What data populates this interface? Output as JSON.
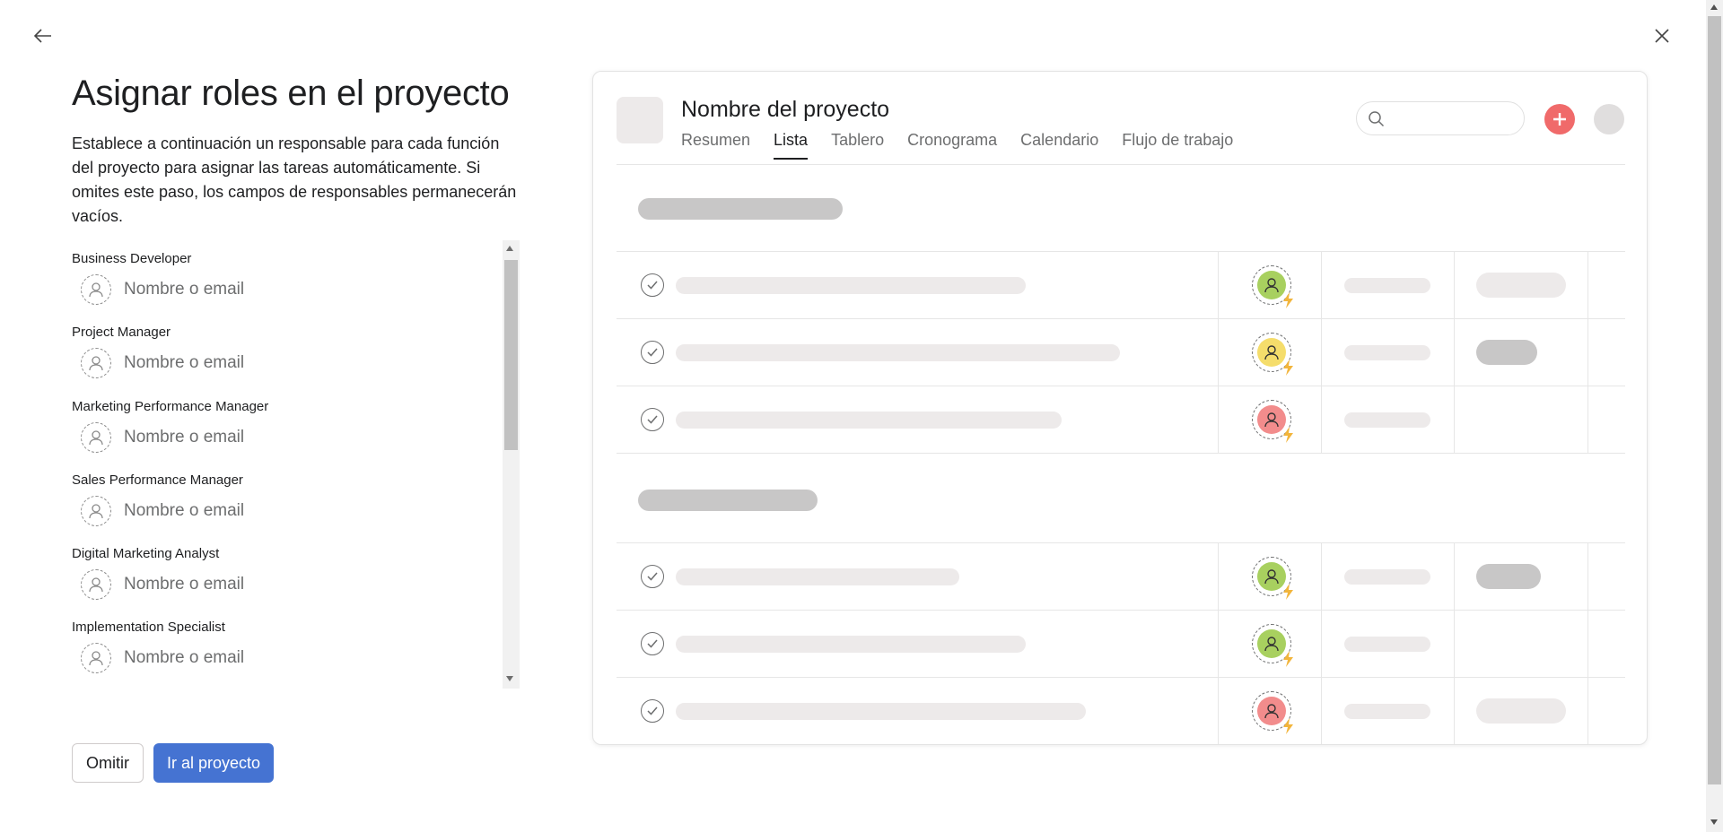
{
  "page": {
    "title": "Asignar roles en el proyecto",
    "description": "Establece a continuación un responsable para cada función del proyecto para asignar las tareas automáticamente. Si omites este paso, los campos de responsables permanecerán vacíos."
  },
  "roles": [
    {
      "label": "Business Developer",
      "placeholder": "Nombre o email"
    },
    {
      "label": "Project Manager",
      "placeholder": "Nombre o email"
    },
    {
      "label": "Marketing Performance Manager",
      "placeholder": "Nombre o email"
    },
    {
      "label": "Sales Performance Manager",
      "placeholder": "Nombre o email"
    },
    {
      "label": "Digital Marketing Analyst",
      "placeholder": "Nombre o email"
    },
    {
      "label": "Implementation Specialist",
      "placeholder": "Nombre o email"
    }
  ],
  "buttons": {
    "skip": "Omitir",
    "go": "Ir al proyecto"
  },
  "preview": {
    "project_title": "Nombre del proyecto",
    "tabs": [
      {
        "label": "Resumen",
        "active": false
      },
      {
        "label": "Lista",
        "active": true
      },
      {
        "label": "Tablero",
        "active": false
      },
      {
        "label": "Cronograma",
        "active": false
      },
      {
        "label": "Calendario",
        "active": false
      },
      {
        "label": "Flujo de trabajo",
        "active": false
      }
    ],
    "assignee_colors": {
      "green": "#a8d05f",
      "yellow": "#f5dd6b",
      "pink": "#f28c8c"
    },
    "accent_colors": {
      "add_button": "#f06a6a",
      "bolt": "#f2b53c",
      "primary_button": "#4573d2"
    }
  }
}
